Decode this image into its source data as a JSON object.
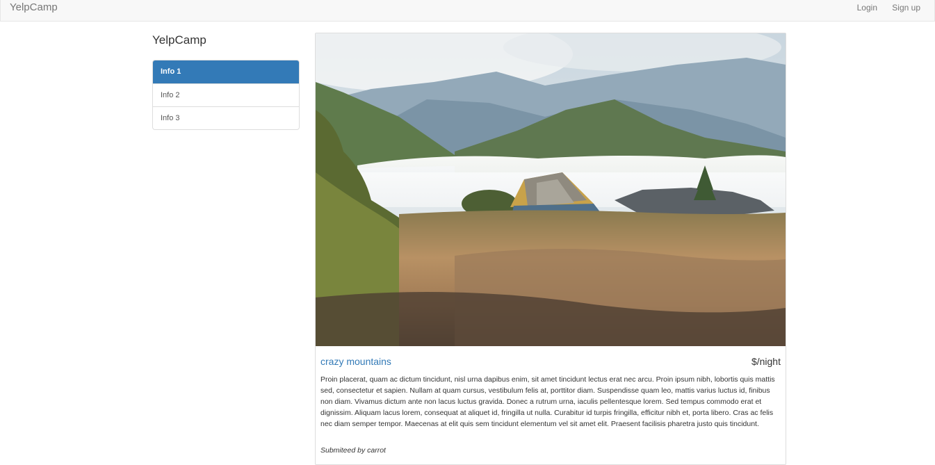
{
  "navbar": {
    "brand": "YelpCamp",
    "login": "Login",
    "signup": "Sign up"
  },
  "sidebar": {
    "title": "YelpCamp",
    "items": [
      {
        "label": "Info 1",
        "active": true
      },
      {
        "label": "Info 2",
        "active": false
      },
      {
        "label": "Info 3",
        "active": false
      }
    ]
  },
  "campground": {
    "name": "crazy mountains",
    "price": "$/night",
    "description": "Proin placerat, quam ac dictum tincidunt, nisl urna dapibus enim, sit amet tincidunt lectus erat nec arcu. Proin ipsum nibh, lobortis quis mattis sed, consectetur et sapien. Nullam at quam cursus, vestibulum felis at, porttitor diam. Suspendisse quam leo, mattis varius luctus id, finibus non diam. Vivamus dictum ante non lacus luctus gravida. Donec a rutrum urna, iaculis pellentesque lorem. Sed tempus commodo erat et dignissim. Aliquam lacus lorem, consequat at aliquet id, fringilla ut nulla. Curabitur id turpis fringilla, efficitur nibh et, porta libero. Cras ac felis nec diam semper tempor. Maecenas at elit quis sem tincidunt elementum vel sit amet elit. Praesent facilisis pharetra justo quis tincidunt.",
    "author": "Submiteed by carrot"
  },
  "colors": {
    "accent": "#337ab7",
    "navbar_bg": "#f8f8f8"
  }
}
